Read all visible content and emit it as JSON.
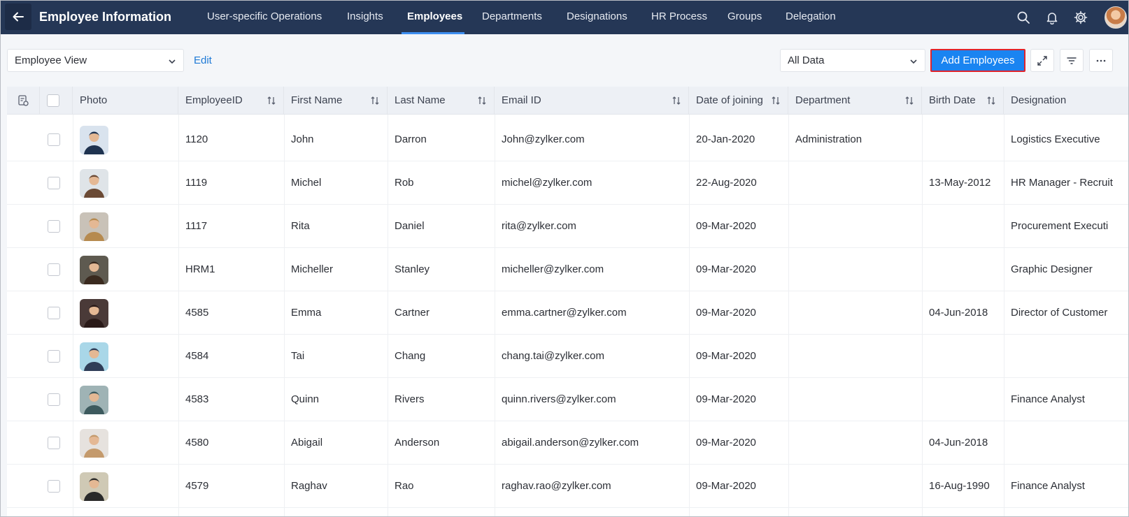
{
  "header": {
    "title": "Employee Information",
    "tabs": [
      {
        "label": "User-specific Operations"
      },
      {
        "label": "Insights"
      },
      {
        "label": "Employees",
        "active": true
      },
      {
        "label": "Departments"
      },
      {
        "label": "Designations"
      },
      {
        "label": "HR Process"
      },
      {
        "label": "Groups"
      },
      {
        "label": "Delegation"
      }
    ],
    "icons": [
      "search-icon",
      "bell-icon",
      "gear-icon",
      "avatar"
    ]
  },
  "toolbar": {
    "view_select": "Employee View",
    "edit_label": "Edit",
    "data_select": "All Data",
    "add_label": "Add Employees"
  },
  "table": {
    "columns": [
      "Photo",
      "EmployeeID",
      "First Name",
      "Last Name",
      "Email ID",
      "Date of joining",
      "Department",
      "Birth Date",
      "Designation"
    ],
    "rows": [
      {
        "id": "1120",
        "first": "John",
        "last": "Darron",
        "email": "John@zylker.com",
        "doj": "20-Jan-2020",
        "dept": "Administration",
        "birth": "",
        "designation": "Logistics Executive",
        "photo_bg": "#d9e3ee",
        "photo_fg": "#1f3350"
      },
      {
        "id": "1119",
        "first": "Michel",
        "last": "Rob",
        "email": "michel@zylker.com",
        "doj": "22-Aug-2020",
        "dept": "",
        "birth": "13-May-2012",
        "designation": "HR Manager - Recruit",
        "photo_bg": "#dfe4e8",
        "photo_fg": "#6b4a35"
      },
      {
        "id": "1117",
        "first": "Rita",
        "last": "Daniel",
        "email": "rita@zylker.com",
        "doj": "09-Mar-2020",
        "dept": "",
        "birth": "",
        "designation": "Procurement Executi",
        "photo_bg": "#c9c2b8",
        "photo_fg": "#b68a4f"
      },
      {
        "id": "HRM1",
        "first": "Micheller",
        "last": "Stanley",
        "email": "micheller@zylker.com",
        "doj": "09-Mar-2020",
        "dept": "",
        "birth": "",
        "designation": "Graphic Designer",
        "photo_bg": "#5e5a50",
        "photo_fg": "#3a2a1f"
      },
      {
        "id": "4585",
        "first": "Emma",
        "last": "Cartner",
        "email": "emma.cartner@zylker.com",
        "doj": "09-Mar-2020",
        "dept": "",
        "birth": "04-Jun-2018",
        "designation": "Director of Customer",
        "photo_bg": "#4a3a38",
        "photo_fg": "#2a1a18"
      },
      {
        "id": "4584",
        "first": "Tai",
        "last": "Chang",
        "email": "chang.tai@zylker.com",
        "doj": "09-Mar-2020",
        "dept": "",
        "birth": "",
        "designation": "",
        "photo_bg": "#a9d7e8",
        "photo_fg": "#2f3d57"
      },
      {
        "id": "4583",
        "first": "Quinn",
        "last": "Rivers",
        "email": "quinn.rivers@zylker.com",
        "doj": "09-Mar-2020",
        "dept": "",
        "birth": "",
        "designation": "Finance Analyst",
        "photo_bg": "#9fb3b5",
        "photo_fg": "#3d5a5e"
      },
      {
        "id": "4580",
        "first": "Abigail",
        "last": "Anderson",
        "email": "abigail.anderson@zylker.com",
        "doj": "09-Mar-2020",
        "dept": "",
        "birth": "04-Jun-2018",
        "designation": "",
        "photo_bg": "#e6e2de",
        "photo_fg": "#c49a6c"
      },
      {
        "id": "4579",
        "first": "Raghav",
        "last": "Rao",
        "email": "raghav.rao@zylker.com",
        "doj": "09-Mar-2020",
        "dept": "",
        "birth": "16-Aug-1990",
        "designation": "Finance Analyst",
        "photo_bg": "#cfc9b5",
        "photo_fg": "#2a2a2a"
      }
    ]
  }
}
